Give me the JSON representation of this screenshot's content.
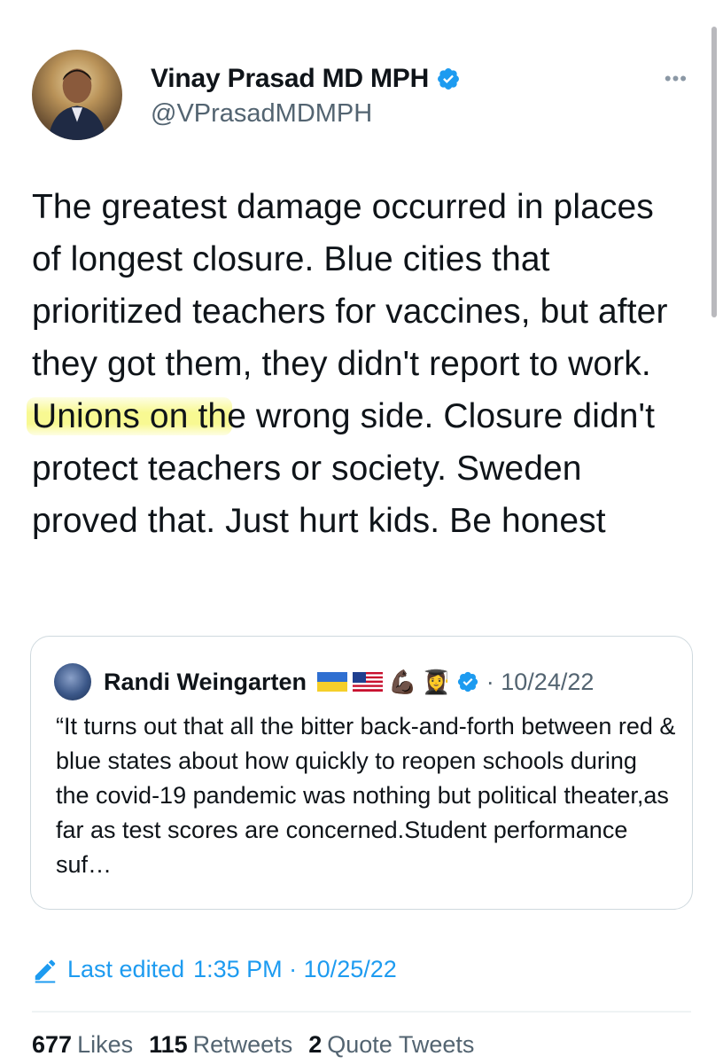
{
  "author": {
    "name": "Vinay Prasad MD MPH",
    "handle": "@VPrasadMDMPH"
  },
  "more_label": "•••",
  "tweet": {
    "before": "The greatest damage occurred in places of longest closure. Blue cities that prioritized teachers for vaccines, but after they got them, they didn't report to work. ",
    "highlight": "Unions on th",
    "after": "e wrong side. Closure didn't protect teachers or society. Sweden proved that. Just hurt kids. Be honest"
  },
  "quote": {
    "name": "Randi Weingarten",
    "emojis": [
      "💪🏿",
      "👩‍🎓"
    ],
    "date": "· 10/24/22",
    "text": "“It turns out that all the bitter back-and-forth between red & blue states about how quickly to reopen schools during the covid-19 pandemic was nothing but political theater,as far as test scores are concerned.Student performance suf…"
  },
  "edited": {
    "label": "Last edited",
    "time": "1:35 PM · 10/25/22"
  },
  "stats": {
    "likes_count": "677",
    "likes_label": "Likes",
    "retweets_count": "115",
    "retweets_label": "Retweets",
    "quotes_count": "2",
    "quotes_label": "Quote Tweets"
  },
  "colors": {
    "accent": "#1d9bf0",
    "highlight": "#f6f76e",
    "muted": "#536471"
  },
  "icons": {
    "verified": "verified-badge-icon",
    "pencil": "pencil-icon",
    "more": "more-dots-icon"
  }
}
